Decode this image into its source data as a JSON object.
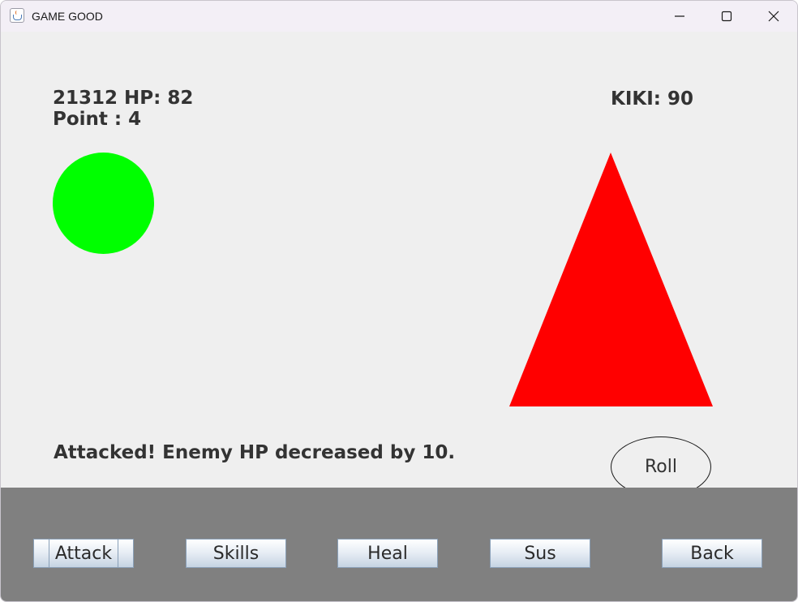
{
  "window": {
    "title": "GAME GOOD",
    "controls": [
      "minimize-icon",
      "maximize-icon",
      "close-icon"
    ]
  },
  "player": {
    "hp_text": "21312 HP: 82",
    "points_text": "Point : 4",
    "shape": "circle",
    "color": "#00ff00"
  },
  "enemy": {
    "hp_text": "KIKI: 90",
    "shape": "triangle",
    "color": "#ff0000"
  },
  "message": "Attacked! Enemy HP decreased by 10.",
  "roll": {
    "label": "Roll"
  },
  "actions": {
    "attack_label": "Attack",
    "skills_label": "Skills",
    "heal_label": "Heal",
    "sus_label": "Sus",
    "back_label": "Back"
  },
  "colors": {
    "background": "#efefef",
    "action_panel": "#808080",
    "text": "#333333"
  }
}
